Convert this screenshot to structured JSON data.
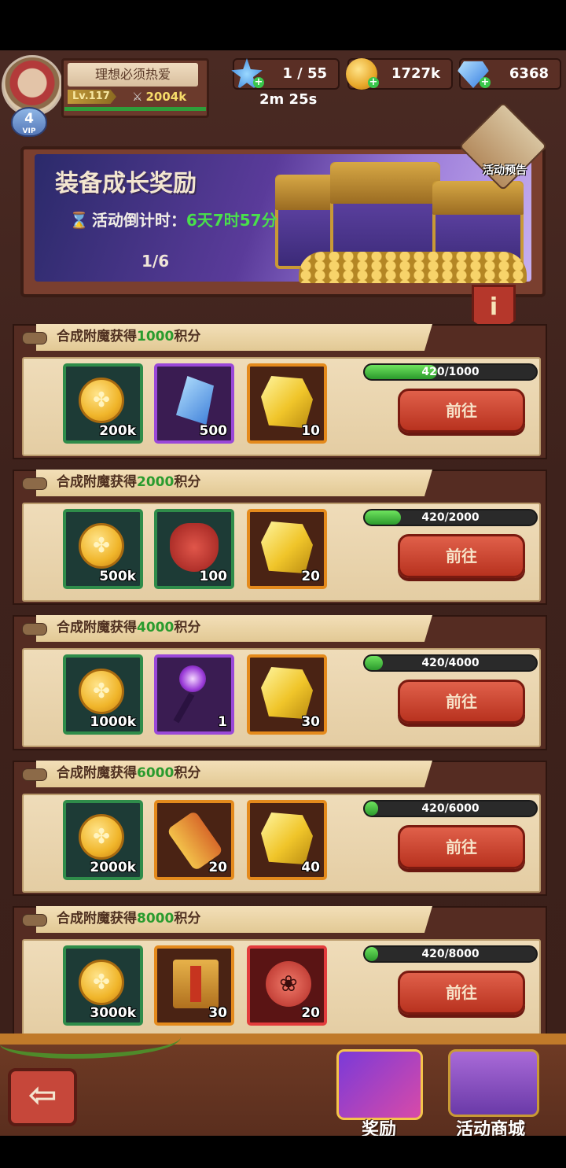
{
  "player": {
    "name": "理想必须热爱",
    "level": "Lv.117",
    "power": "2004k",
    "vip_level": "4",
    "vip_label": "VIP"
  },
  "resources": {
    "stamina": "1 / 55",
    "stamina_timer": "2m 25s",
    "gold": "1727k",
    "gems": "6368"
  },
  "banner": {
    "title": "装备成长奖励",
    "countdown_label": "活动倒计时：",
    "countdown_value": "6天7时57分",
    "page": "1/6",
    "preview_label": "活动预告",
    "info_symbol": "i"
  },
  "tasks": [
    {
      "title_prefix": "合成附魔获得",
      "title_points": "1000",
      "title_suffix": "积分",
      "rewards": [
        {
          "icon": "gold-coin-icon",
          "count": "200k"
        },
        {
          "icon": "blue-crystal-icon",
          "count": "500"
        },
        {
          "icon": "gold-ore-icon",
          "count": "10"
        }
      ],
      "progress_text": "420/1000",
      "progress": 0.42,
      "button": "前往"
    },
    {
      "title_prefix": "合成附魔获得",
      "title_points": "2000",
      "title_suffix": "积分",
      "rewards": [
        {
          "icon": "gold-coin-icon",
          "count": "500k"
        },
        {
          "icon": "red-bag-icon",
          "count": "100"
        },
        {
          "icon": "gold-ore-icon",
          "count": "20"
        }
      ],
      "progress_text": "420/2000",
      "progress": 0.21,
      "button": "前往"
    },
    {
      "title_prefix": "合成附魔获得",
      "title_points": "4000",
      "title_suffix": "积分",
      "rewards": [
        {
          "icon": "gold-coin-icon",
          "count": "1000k"
        },
        {
          "icon": "purple-staff-icon",
          "count": "1"
        },
        {
          "icon": "gold-ore-icon",
          "count": "30"
        }
      ],
      "progress_text": "420/4000",
      "progress": 0.105,
      "button": "前往"
    },
    {
      "title_prefix": "合成附魔获得",
      "title_points": "6000",
      "title_suffix": "积分",
      "rewards": [
        {
          "icon": "gold-coin-icon",
          "count": "2000k"
        },
        {
          "icon": "scroll-icon",
          "count": "20"
        },
        {
          "icon": "gold-ore-icon",
          "count": "40"
        }
      ],
      "progress_text": "420/6000",
      "progress": 0.07,
      "button": "前往"
    },
    {
      "title_prefix": "合成附魔获得",
      "title_points": "8000",
      "title_suffix": "积分",
      "rewards": [
        {
          "icon": "gold-coin-icon",
          "count": "3000k"
        },
        {
          "icon": "book-icon",
          "count": "30"
        },
        {
          "icon": "paw-token-icon",
          "count": "20"
        }
      ],
      "progress_text": "420/8000",
      "progress": 0.0525,
      "button": "前往"
    }
  ],
  "bottom": {
    "back_icon": "back-arrow-icon",
    "reward_tab": "奖励",
    "shop_tab": "活动商城"
  }
}
